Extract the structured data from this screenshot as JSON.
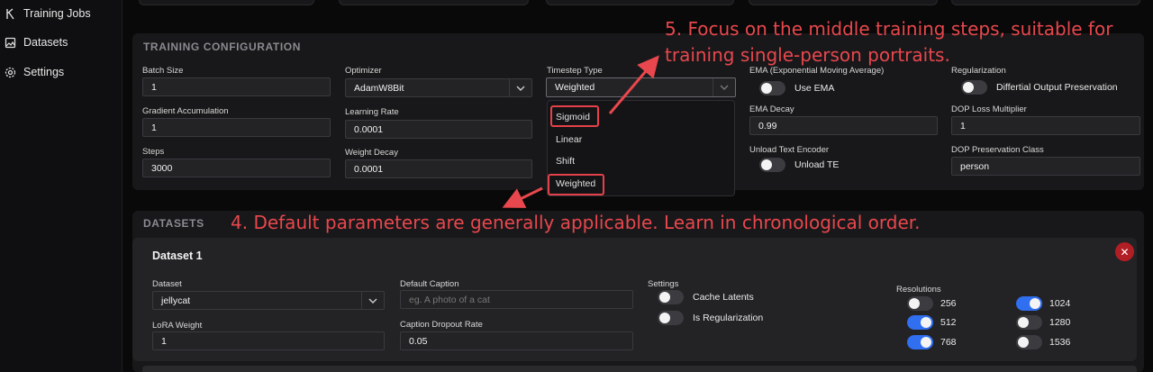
{
  "sidebar": {
    "items": [
      {
        "label": "Training Jobs",
        "icon": "training-jobs-icon"
      },
      {
        "label": "Datasets",
        "icon": "datasets-icon"
      },
      {
        "label": "Settings",
        "icon": "gear-icon"
      }
    ]
  },
  "training": {
    "title": "TRAINING CONFIGURATION",
    "batch_size": {
      "label": "Batch Size",
      "value": "1"
    },
    "grad_accum": {
      "label": "Gradient Accumulation",
      "value": "1"
    },
    "steps": {
      "label": "Steps",
      "value": "3000"
    },
    "optimizer": {
      "label": "Optimizer",
      "value": "AdamW8Bit"
    },
    "learning_rate": {
      "label": "Learning Rate",
      "value": "0.0001"
    },
    "weight_decay": {
      "label": "Weight Decay",
      "value": "0.0001"
    },
    "timestep_type": {
      "label": "Timestep Type",
      "value": "Weighted",
      "options": [
        "Sigmoid",
        "Linear",
        "Shift",
        "Weighted"
      ]
    },
    "ema": {
      "label": "EMA (Exponential Moving Average)",
      "toggle_label": "Use EMA",
      "on": false
    },
    "ema_decay": {
      "label": "EMA Decay",
      "value": "0.99"
    },
    "unload_te": {
      "label": "Unload Text Encoder",
      "toggle_label": "Unload TE",
      "on": false
    },
    "regularization": {
      "label": "Regularization",
      "toggle_label": "Differtial Output Preservation",
      "on": false
    },
    "dop_loss": {
      "label": "DOP Loss Multiplier",
      "value": "1"
    },
    "dop_class": {
      "label": "DOP Preservation Class",
      "value": "person"
    }
  },
  "datasets": {
    "title": "DATASETS",
    "card": {
      "title": "Dataset 1",
      "dataset": {
        "label": "Dataset",
        "value": "jellycat"
      },
      "lora_weight": {
        "label": "LoRA Weight",
        "value": "1"
      },
      "default_caption": {
        "label": "Default Caption",
        "placeholder": "eg. A photo of a cat"
      },
      "caption_dropout": {
        "label": "Caption Dropout Rate",
        "value": "0.05"
      },
      "settings": {
        "label": "Settings",
        "cache_latents": "Cache Latents",
        "is_regularization": "Is Regularization"
      },
      "resolutions": {
        "label": "Resolutions",
        "items": [
          {
            "value": "256",
            "on": false
          },
          {
            "value": "512",
            "on": true
          },
          {
            "value": "768",
            "on": true
          },
          {
            "value": "1024",
            "on": true
          },
          {
            "value": "1280",
            "on": false
          },
          {
            "value": "1536",
            "on": false
          }
        ]
      }
    }
  },
  "annotations": {
    "note5_line1": "5. Focus on the middle training steps, suitable for",
    "note5_line2": "training single-person portraits.",
    "note4": "4. Default parameters are generally applicable. Learn in chronological order."
  },
  "colors": {
    "accent": "#2f6ff0",
    "annotation": "#e8474d",
    "danger": "#b11e24"
  }
}
